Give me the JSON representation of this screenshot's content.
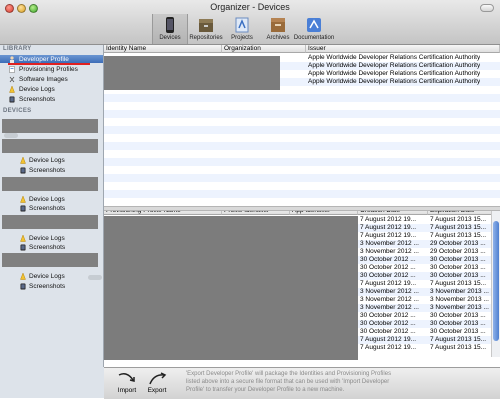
{
  "window": {
    "title": "Organizer - Devices"
  },
  "toolbar": {
    "items": [
      {
        "label": "Devices",
        "icon": "devices-icon"
      },
      {
        "label": "Repositories",
        "icon": "repositories-icon"
      },
      {
        "label": "Projects",
        "icon": "projects-icon"
      },
      {
        "label": "Archives",
        "icon": "archives-icon"
      },
      {
        "label": "Documentation",
        "icon": "documentation-icon"
      }
    ]
  },
  "sidebar": {
    "library_header": "LIBRARY",
    "devices_header": "DEVICES",
    "library_items": [
      {
        "label": "Developer Profile",
        "icon": "developer-profile-icon",
        "selected": true
      },
      {
        "label": "Provisioning Profiles",
        "icon": "provisioning-icon"
      },
      {
        "label": "Software Images",
        "icon": "software-images-icon"
      },
      {
        "label": "Device Logs",
        "icon": "device-logs-icon"
      },
      {
        "label": "Screenshots",
        "icon": "screenshots-icon"
      }
    ],
    "device_sub": {
      "logs": "Device Logs",
      "shots": "Screenshots"
    }
  },
  "identity_table": {
    "columns": [
      "Identity Name",
      "Organization",
      "Issuer"
    ],
    "issuer_rows": [
      "Apple Worldwide Developer Relations Certification Authority",
      "Apple Worldwide Developer Relations Certification Authority",
      "Apple Worldwide Developer Relations Certification Authority",
      "Apple Worldwide Developer Relations Certification Authority"
    ]
  },
  "profiles_table": {
    "columns": [
      "Provisioning Profile Name",
      "Profile Identifier",
      "App Identifier",
      "Creation Date",
      "Expiration Date"
    ],
    "rows": [
      {
        "created": "7 August 2012 19...",
        "expires": "7 August 2013 15..."
      },
      {
        "created": "7 August 2012 19...",
        "expires": "7 August 2013 15..."
      },
      {
        "created": "7 August 2012 19...",
        "expires": "7 August 2013 15..."
      },
      {
        "created": "3 November 2012 ...",
        "expires": "29 October 2013 ..."
      },
      {
        "created": "3 November 2012 ...",
        "expires": "29 October 2013 ..."
      },
      {
        "created": "30 October 2012 ...",
        "expires": "30 October 2013 ..."
      },
      {
        "created": "30 October 2012 ...",
        "expires": "30 October 2013 ..."
      },
      {
        "created": "30 October 2012 ...",
        "expires": "30 October 2013 ..."
      },
      {
        "created": "7 August 2012 19...",
        "expires": "7 August 2013 15..."
      },
      {
        "created": "3 November 2012 ...",
        "expires": "3 November 2013 ..."
      },
      {
        "created": "3 November 2012 ...",
        "expires": "3 November 2013 ..."
      },
      {
        "created": "3 November 2012 ...",
        "expires": "3 November 2013 ..."
      },
      {
        "created": "30 October 2012 ...",
        "expires": "30 October 2013 ..."
      },
      {
        "created": "30 October 2012 ...",
        "expires": "30 October 2013 ..."
      },
      {
        "created": "30 October 2012 ...",
        "expires": "30 October 2013 ..."
      },
      {
        "created": "7 August 2012 19...",
        "expires": "7 August 2013 15..."
      },
      {
        "created": "7 August 2012 19...",
        "expires": "7 August 2013 15..."
      }
    ]
  },
  "bottom": {
    "import_label": "Import",
    "export_label": "Export",
    "description": "'Export Developer Profile' will package the Identities and Provisioning Profiles listed above into a secure file format that can be used with 'Import Developer Profile' to transfer your Developer Profile to a new machine."
  }
}
